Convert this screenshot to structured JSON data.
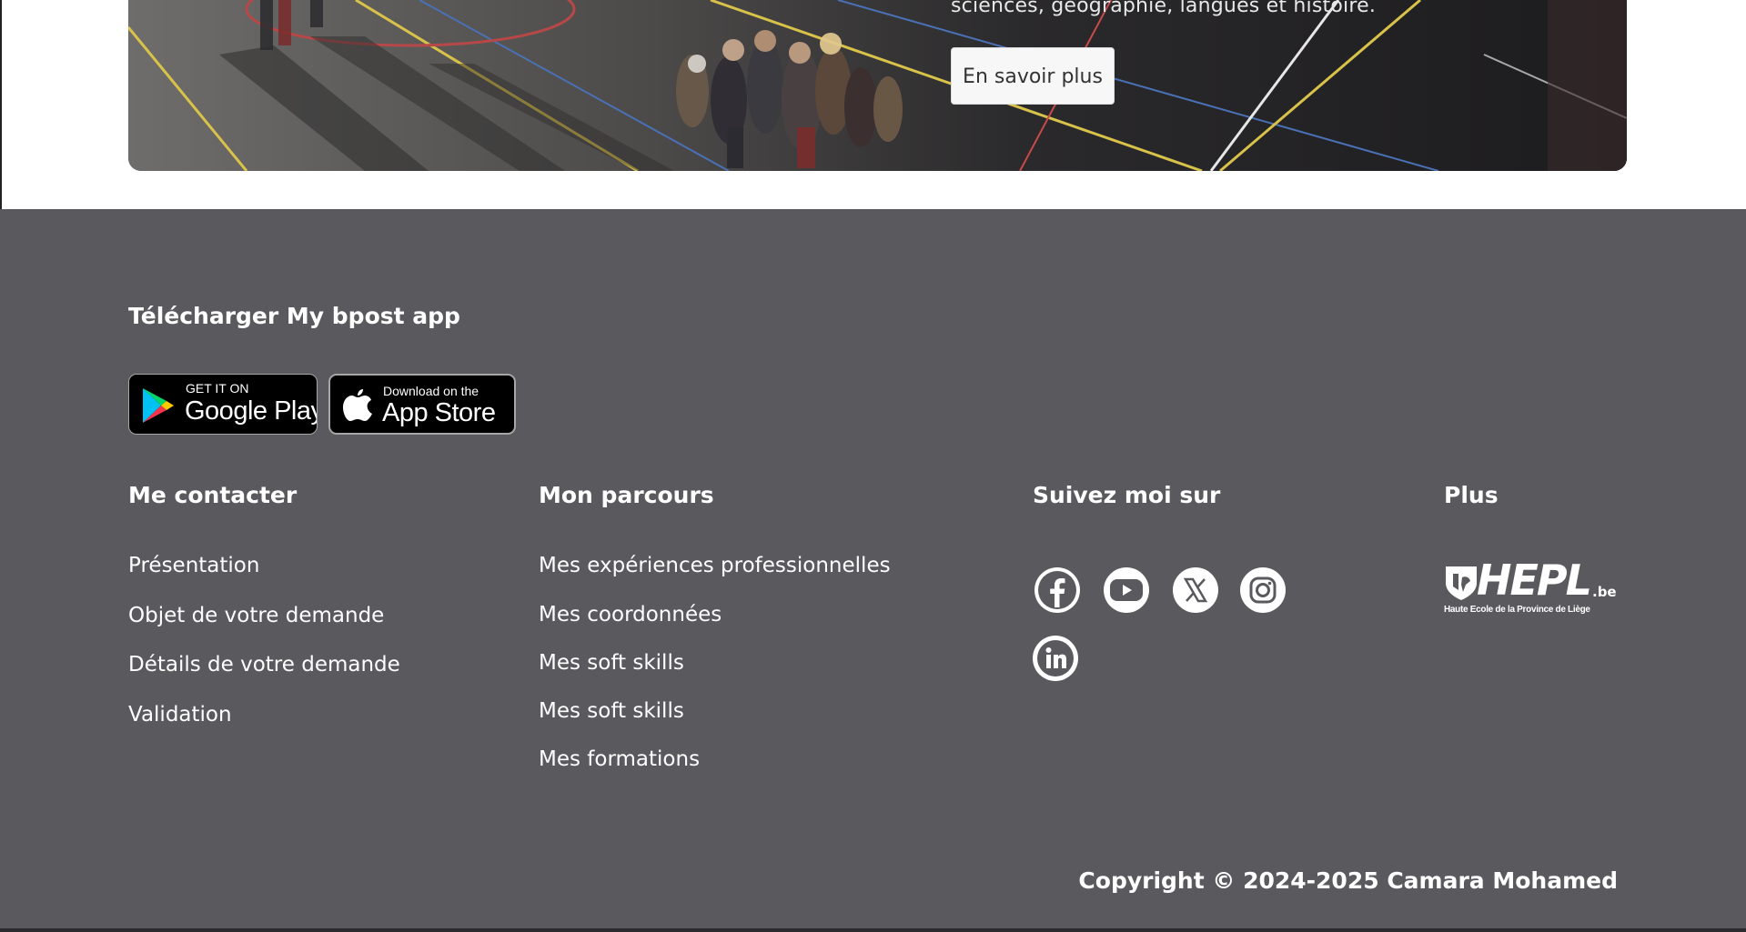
{
  "hero": {
    "description_fragment": "sciences, géographie, langues et histoire.",
    "button_label": "En savoir plus"
  },
  "footer": {
    "app_title": "Télécharger My bpost app",
    "badges": {
      "google_small": "GET IT ON",
      "google_big": "Google Play",
      "apple_small": "Download on the",
      "apple_big": "App Store"
    },
    "columns": {
      "contact": {
        "title": "Me contacter",
        "links": [
          "Présentation",
          "Objet de votre demande",
          "Détails de votre demande",
          "Validation"
        ]
      },
      "parcours": {
        "title": "Mon parcours",
        "links": [
          "Mes expériences professionnelles",
          "Mes coordonnées",
          "Mes soft skills",
          "Mes soft skills",
          "Mes formations"
        ]
      },
      "social": {
        "title": "Suivez moi sur",
        "icons": [
          "facebook-icon",
          "youtube-icon",
          "x-icon",
          "instagram-icon",
          "linkedin-icon"
        ]
      },
      "plus": {
        "title": "Plus",
        "logo_text": "HEPL",
        "logo_suffix": ".be",
        "logo_caption": "Haute Ecole de la Province de Liège"
      }
    },
    "copyright": "Copyright © 2024-2025 Camara Mohamed"
  },
  "colors": {
    "footer_bg": "#5a595e",
    "text": "#ffffff",
    "button_bg": "#f7f7f7"
  }
}
